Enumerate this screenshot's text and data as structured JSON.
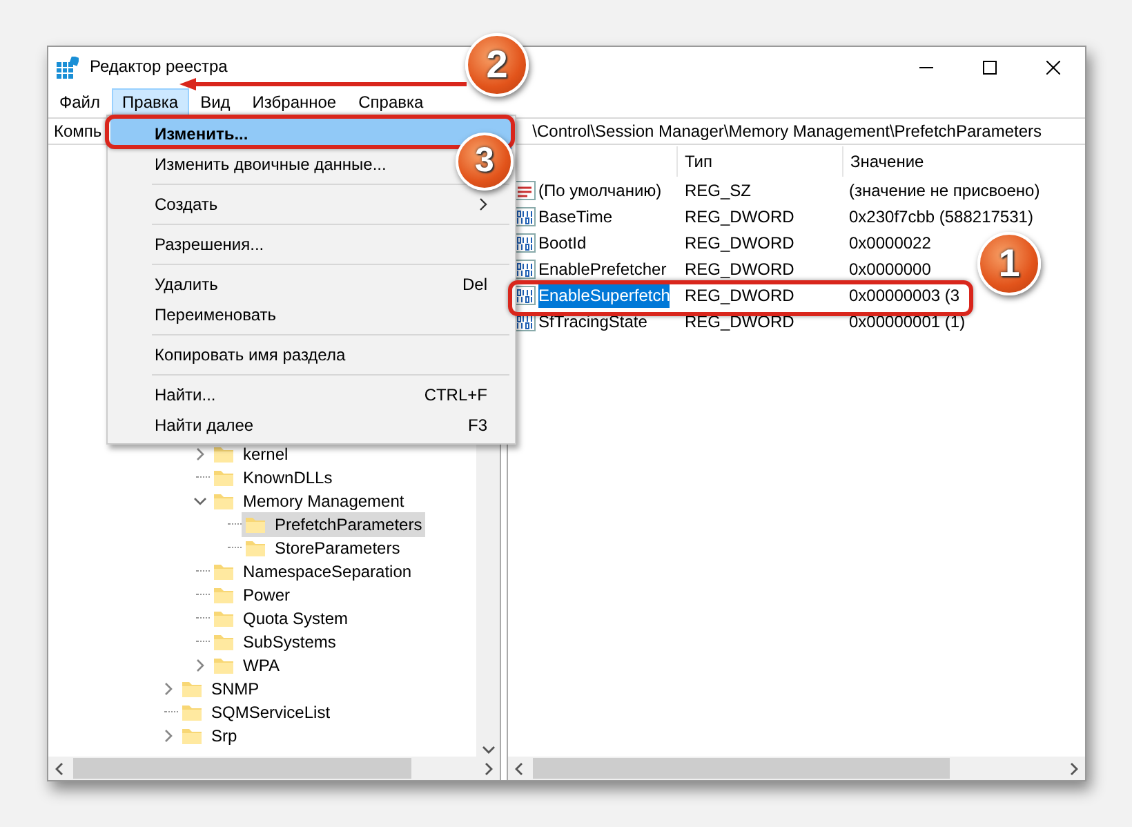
{
  "window": {
    "title": "Редактор реестра"
  },
  "menu_bar": [
    {
      "label": "Файл",
      "selected": false
    },
    {
      "label": "Правка",
      "selected": true,
      "callout": "2"
    },
    {
      "label": "Вид",
      "selected": false
    },
    {
      "label": "Избранное",
      "selected": false
    },
    {
      "label": "Справка",
      "selected": false
    }
  ],
  "address_bar": {
    "segments": [
      "Компь",
      "\\Control\\Session Manager\\Memory Management\\PrefetchParameters"
    ]
  },
  "dropdown_menu": {
    "items": [
      {
        "kind": "item",
        "label": "Изменить...",
        "selected": true,
        "circled": true,
        "callout": "3"
      },
      {
        "kind": "item",
        "label": "Изменить двоичные данные...",
        "selected": false,
        "circled": false
      },
      {
        "kind": "separator"
      },
      {
        "kind": "submenu",
        "label": "Создать",
        "selected": false,
        "circled": false
      },
      {
        "kind": "separator"
      },
      {
        "kind": "item",
        "label": "Разрешения...",
        "selected": false,
        "circled": false
      },
      {
        "kind": "separator"
      },
      {
        "kind": "item",
        "label": "Удалить",
        "shortcut": "Del",
        "selected": false,
        "circled": false
      },
      {
        "kind": "item",
        "label": "Переименовать",
        "selected": false,
        "circled": false
      },
      {
        "kind": "separator"
      },
      {
        "kind": "item",
        "label": "Копировать имя раздела",
        "selected": false,
        "circled": false
      },
      {
        "kind": "separator"
      },
      {
        "kind": "item",
        "label": "Найти...",
        "shortcut": "CTRL+F",
        "selected": false,
        "circled": false
      },
      {
        "kind": "item",
        "label": "Найти далее",
        "shortcut": "F3",
        "selected": false,
        "circled": false
      }
    ]
  },
  "tree": {
    "items": [
      {
        "children": [
          {
            "label": "kernel",
            "kind": "branch",
            "expanded": false,
            "selected": false
          },
          {
            "label": "KnownDLLs",
            "kind": "leaf",
            "selected": false
          },
          {
            "label": "Memory Management",
            "kind": "branch",
            "expanded": true,
            "selected": false,
            "children": [
              {
                "label": "PrefetchParameters",
                "kind": "leaf",
                "selected": true
              },
              {
                "label": "StoreParameters",
                "kind": "leaf",
                "selected": false
              }
            ]
          },
          {
            "label": "NamespaceSeparation",
            "kind": "leaf",
            "selected": false
          },
          {
            "label": "Power",
            "kind": "leaf",
            "selected": false
          },
          {
            "label": "Quota System",
            "kind": "leaf",
            "selected": false
          },
          {
            "label": "SubSystems",
            "kind": "leaf",
            "selected": false
          },
          {
            "label": "WPA",
            "kind": "branch",
            "expanded": false,
            "selected": false
          }
        ]
      },
      {
        "label": "SNMP",
        "kind": "branch",
        "expanded": false,
        "selected": false
      },
      {
        "label": "SQMServiceList",
        "kind": "leaf",
        "selected": false
      },
      {
        "label": "Srp",
        "kind": "branch",
        "expanded": false,
        "selected": false
      }
    ]
  },
  "values": {
    "columns": [
      {
        "label": "Тип"
      },
      {
        "label": "Значение"
      }
    ],
    "rows": [
      {
        "kind": "string",
        "name": "(По умолчанию)",
        "type": "REG_SZ",
        "value": "(значение не присвоено)",
        "selected": false,
        "circled": false
      },
      {
        "kind": "binary",
        "name": "BaseTime",
        "type": "REG_DWORD",
        "value": "0x230f7cbb (588217531)",
        "selected": false,
        "circled": false
      },
      {
        "kind": "binary",
        "name": "BootId",
        "type": "REG_DWORD",
        "value": "0x0000022",
        "selected": false,
        "circled": false
      },
      {
        "kind": "binary",
        "name": "EnablePrefetcher",
        "type": "REG_DWORD",
        "value": "0x0000000",
        "selected": false,
        "circled": false
      },
      {
        "kind": "binary",
        "name": "EnableSuperfetch",
        "type": "REG_DWORD",
        "value": "0x00000003 (3",
        "selected": true,
        "circled": true,
        "callout": "1"
      },
      {
        "kind": "binary",
        "name": "SfTracingState",
        "type": "REG_DWORD",
        "value": "0x00000001 (1)",
        "selected": false,
        "circled": false
      }
    ]
  }
}
